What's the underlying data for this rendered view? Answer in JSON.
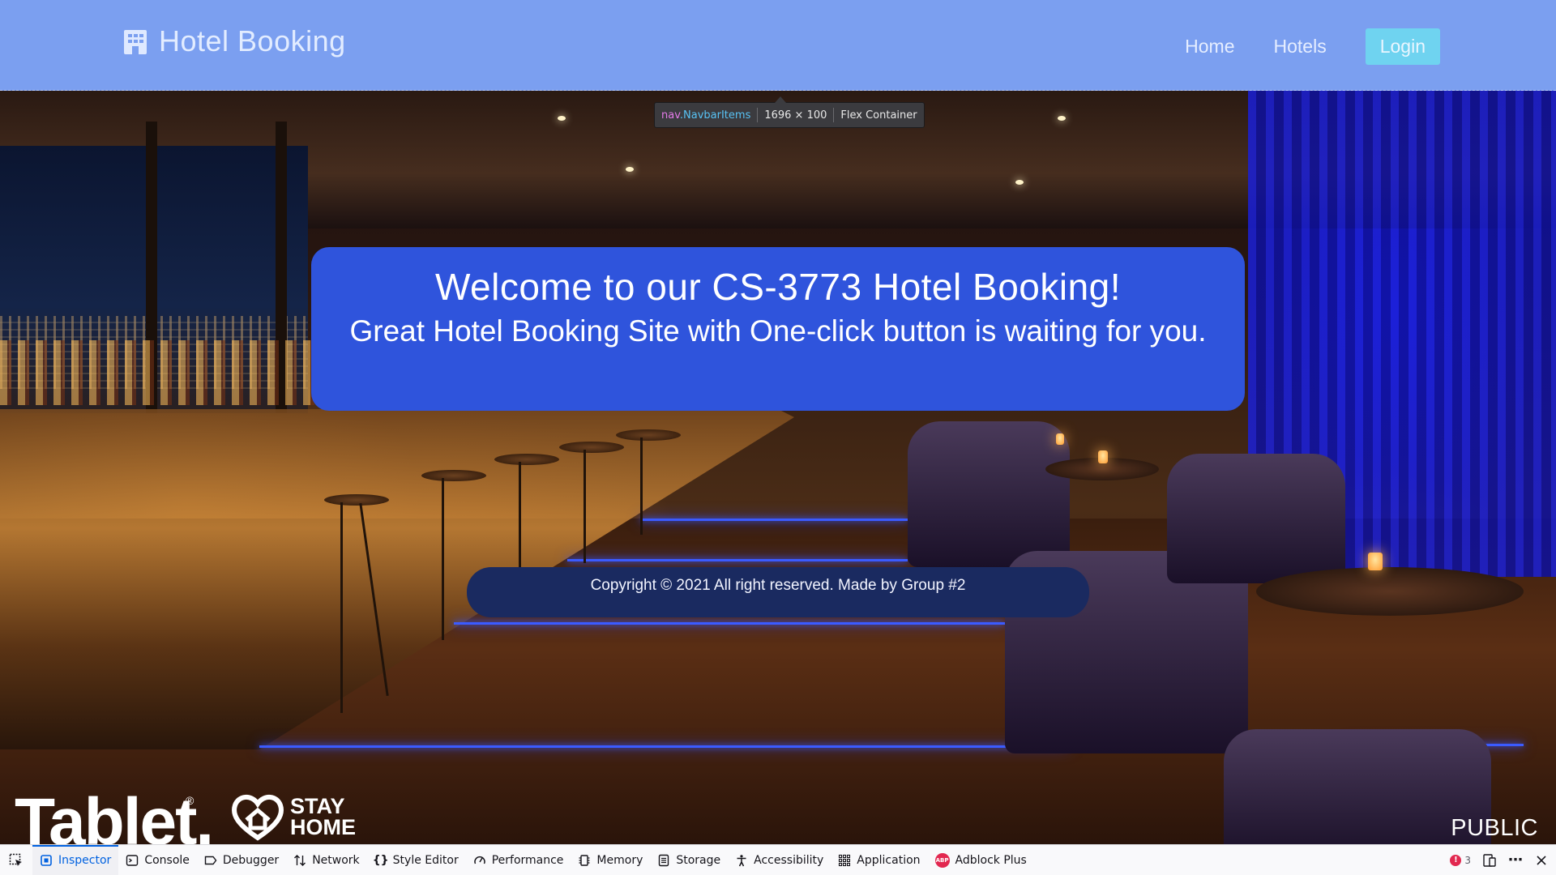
{
  "navbar": {
    "brand_title": "Hotel Booking",
    "brand_icon": "hotel-building-icon",
    "links": [
      "Home",
      "Hotels"
    ],
    "login_label": "Login"
  },
  "devtools_tooltip": {
    "tag": "nav",
    "class_name": ".NavbarItems",
    "size": "1696 × 100",
    "kind": "Flex Container"
  },
  "welcome": {
    "heading": "Welcome to our CS-3773 Hotel Booking!",
    "subheading": "Great Hotel Booking Site with One-click button is waiting for you."
  },
  "footer": {
    "copyright": "Copyright © 2021 All right reserved. Made by Group #2"
  },
  "watermarks": {
    "brand": "Tablet.",
    "registered": "®",
    "stay_home": [
      "STAY",
      "HOME"
    ],
    "label": "PUBLIC"
  },
  "devtools": {
    "tabs": [
      {
        "label": "Inspector",
        "icon": "inspector-icon",
        "active": true
      },
      {
        "label": "Console",
        "icon": "console-icon",
        "active": false
      },
      {
        "label": "Debugger",
        "icon": "debugger-icon",
        "active": false
      },
      {
        "label": "Network",
        "icon": "network-icon",
        "active": false
      },
      {
        "label": "Style Editor",
        "icon": "style-editor-icon",
        "active": false
      },
      {
        "label": "Performance",
        "icon": "performance-icon",
        "active": false
      },
      {
        "label": "Memory",
        "icon": "memory-icon",
        "active": false
      },
      {
        "label": "Storage",
        "icon": "storage-icon",
        "active": false
      },
      {
        "label": "Accessibility",
        "icon": "accessibility-icon",
        "active": false
      },
      {
        "label": "Application",
        "icon": "application-icon",
        "active": false
      },
      {
        "label": "Adblock Plus",
        "icon": "adblock-plus-icon",
        "active": false
      }
    ],
    "error_count": "3",
    "abp_badge": "ABP"
  },
  "colors": {
    "navbar_bg": "#7b9ff0",
    "login_bg": "#6fd3f0",
    "welcome_bg": "#2f54dc",
    "footer_bg": "#1a2a60",
    "devtools_active": "#0061e0"
  }
}
